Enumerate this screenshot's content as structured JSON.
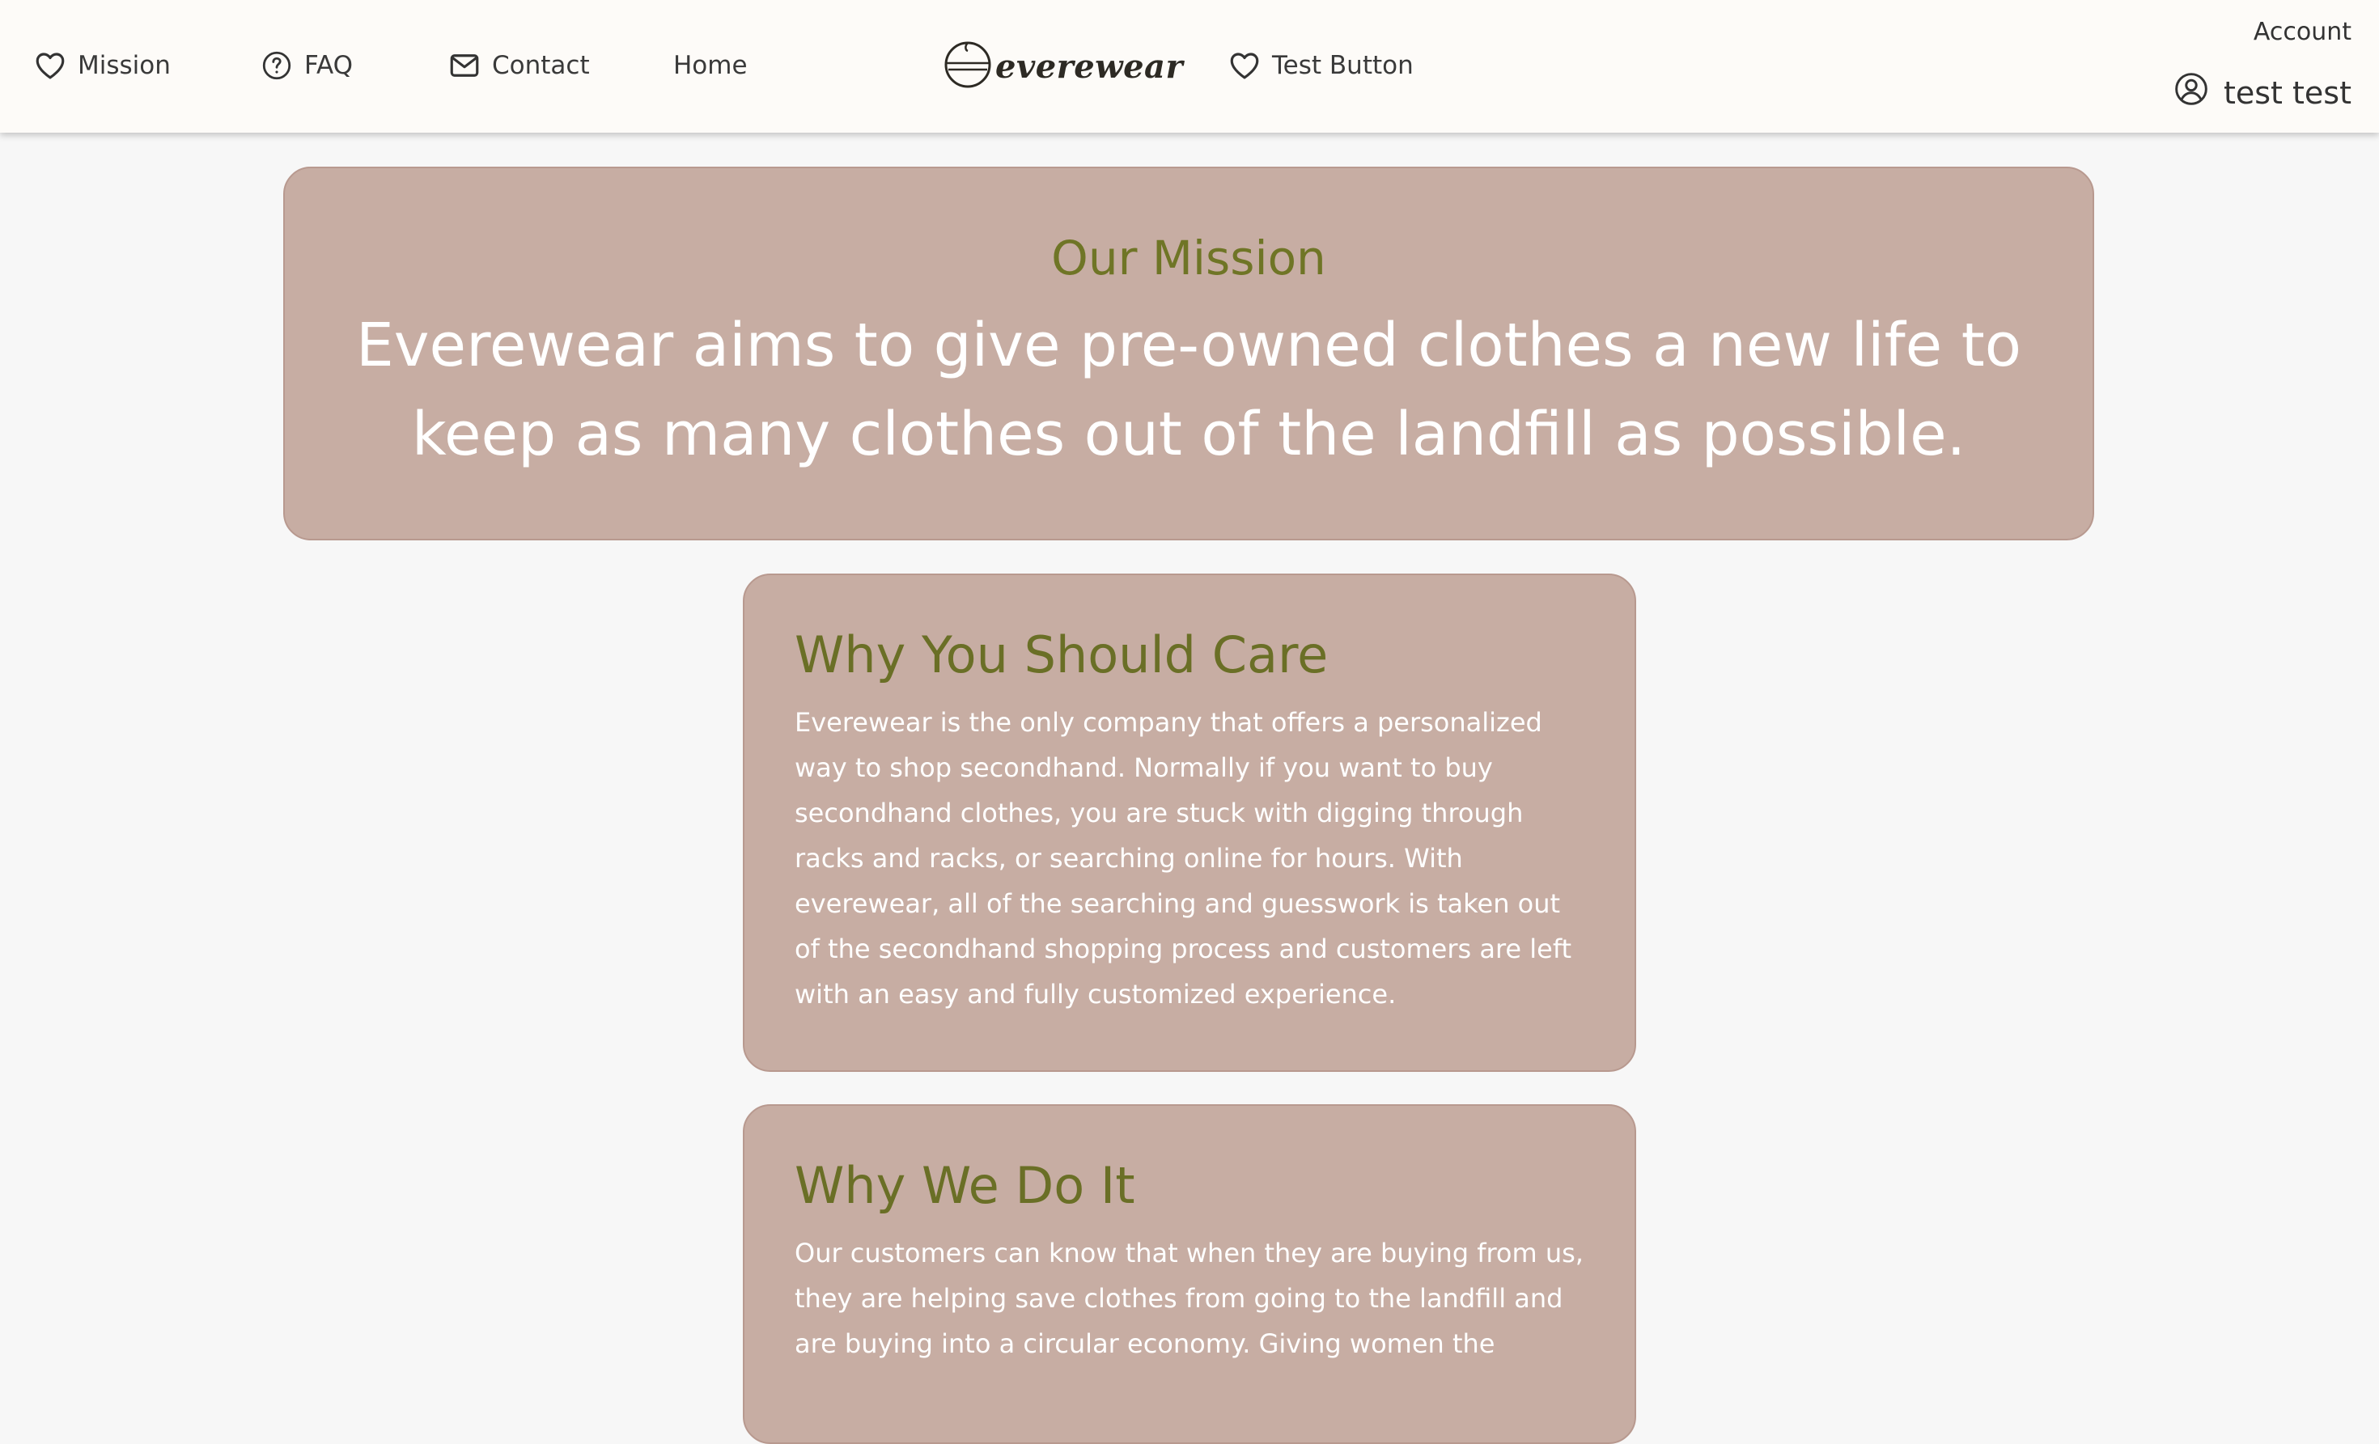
{
  "nav": {
    "mission": "Mission",
    "faq": "FAQ",
    "contact": "Contact",
    "home": "Home",
    "test_button": "Test Button",
    "logo_text": "everewear"
  },
  "account": {
    "label": "Account",
    "user_name": "test test"
  },
  "mission": {
    "title": "Our Mission",
    "text": "Everewear aims to give pre-owned clothes a new life to keep as many clothes out of the landfill as possible."
  },
  "cards": [
    {
      "title": "Why You Should Care",
      "text": "Everewear is the only company that offers a personalized way to shop secondhand. Normally if you want to buy secondhand clothes, you are stuck with digging through racks and racks, or searching online for hours. With everewear, all of the searching and guesswork is taken out of the secondhand shopping process and customers are left with an easy and fully customized experience."
    },
    {
      "title": "Why We Do It",
      "text": "Our customers can know that when they are buying from us, they are helping save clothes from going to the landfill and are buying into a circular economy. Giving women the"
    }
  ],
  "icons": {
    "mission": "heart-icon",
    "faq": "question-circle-icon",
    "contact": "envelope-icon",
    "test_button": "heart-icon",
    "logo": "hanger-circle-icon",
    "account": "user-circle-icon"
  },
  "colors": {
    "card_bg": "#c7ada3",
    "heading_olive": "#6f7526",
    "navbar_bg": "#fdfbf8",
    "page_bg": "#f7f7f7"
  }
}
